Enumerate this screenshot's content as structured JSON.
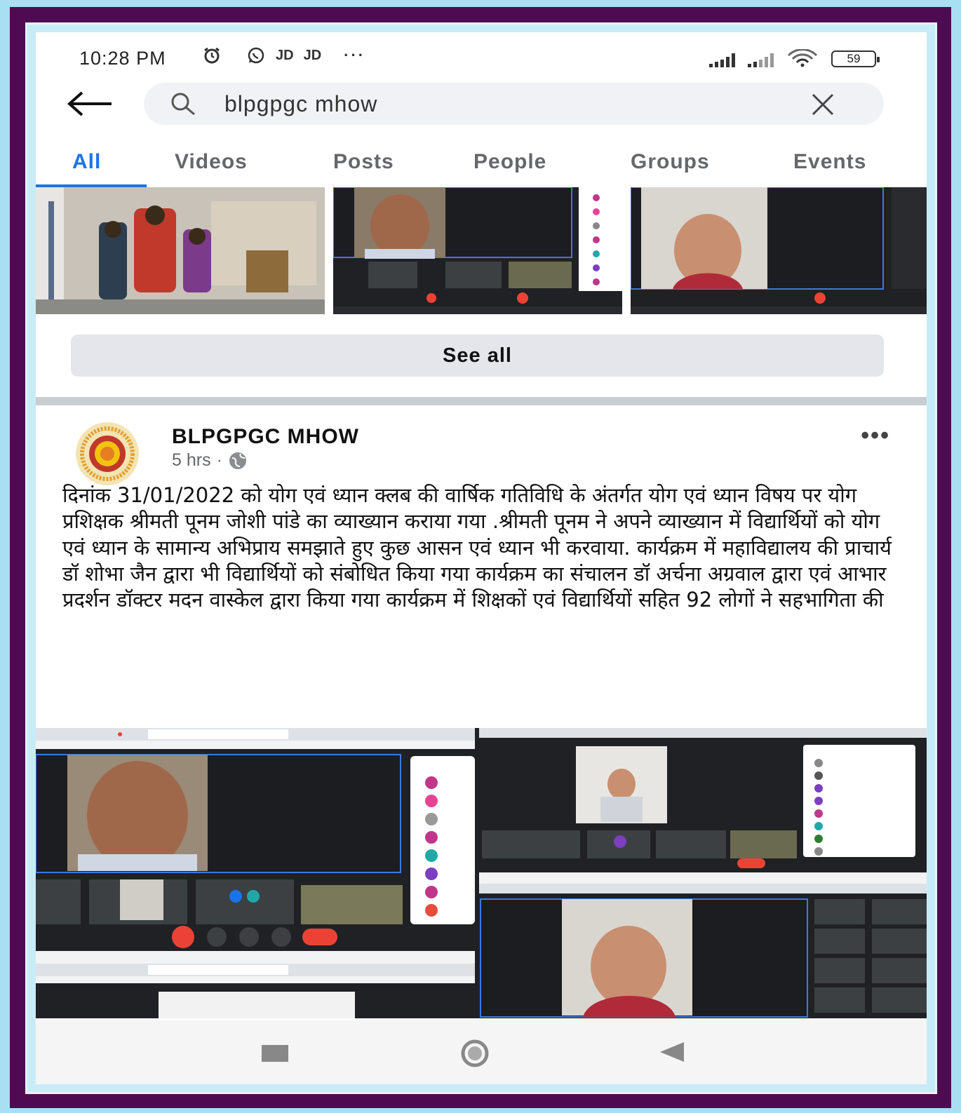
{
  "status_bar": {
    "time": "10:28 PM",
    "carrier_1": "JD",
    "carrier_2": "JD",
    "battery": "59"
  },
  "search": {
    "query": "blpgpgc mhow"
  },
  "tabs": [
    {
      "label": "All",
      "active": true
    },
    {
      "label": "Videos"
    },
    {
      "label": "Posts"
    },
    {
      "label": "People"
    },
    {
      "label": "Groups"
    },
    {
      "label": "Events"
    }
  ],
  "see_all_label": "See all",
  "post": {
    "page_name": "BLPGPGC MHOW",
    "time": "5 hrs",
    "text": "दिनांक 31/01/2022 को योग एवं ध्यान क्लब की वार्षिक गतिविधि के अंतर्गत योग एवं ध्यान विषय पर योग प्रशिक्षक श्रीमती पूनम जोशी पांडे का व्याख्यान कराया गया .श्रीमती पूनम ने अपने व्याख्यान में विद्यार्थियों को योग एवं ध्यान के सामान्य अभिप्राय समझाते हुए कुछ आसन एवं ध्यान भी करवाया. कार्यक्रम में महाविद्यालय की प्राचार्य डॉ शोभा जैन द्वारा भी विद्यार्थियों को संबोधित किया गया कार्यक्रम का संचालन डॉ अर्चना अग्रवाल द्वारा एवं आभार प्रदर्शन डॉक्टर मदन वास्केल द्वारा किया गया कार्यक्रम में शिक्षकों एवं विद्यार्थियों सहित 92 लोगों ने सहभागिता की"
  },
  "colors": {
    "accent": "#1b74e4",
    "frame": "#4f0b52",
    "outer": "#a9dff2"
  }
}
